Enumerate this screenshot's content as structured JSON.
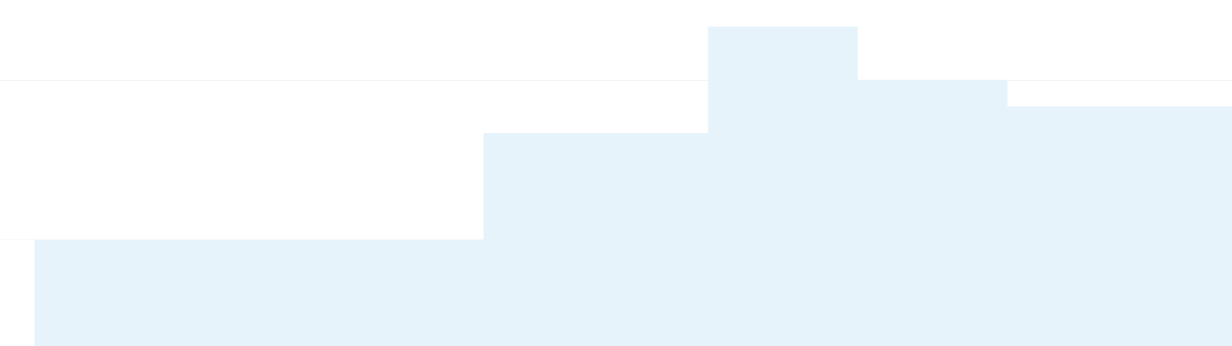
{
  "chart_data": {
    "type": "area",
    "step": "horizontal",
    "title": "",
    "xlabel": "",
    "ylabel": "",
    "x": [
      0,
      6,
      9,
      11,
      13,
      16
    ],
    "series": [
      {
        "values": [
          3,
          5,
          7,
          6,
          5.5,
          5.5
        ]
      }
    ],
    "xlim": [
      0,
      16
    ],
    "ylim": [
      1,
      7.5
    ],
    "grid": true,
    "legend": "none",
    "colors": {
      "fill": "#e6f3fb",
      "background": "#ffffff",
      "grid": "#f4f4f4"
    }
  }
}
